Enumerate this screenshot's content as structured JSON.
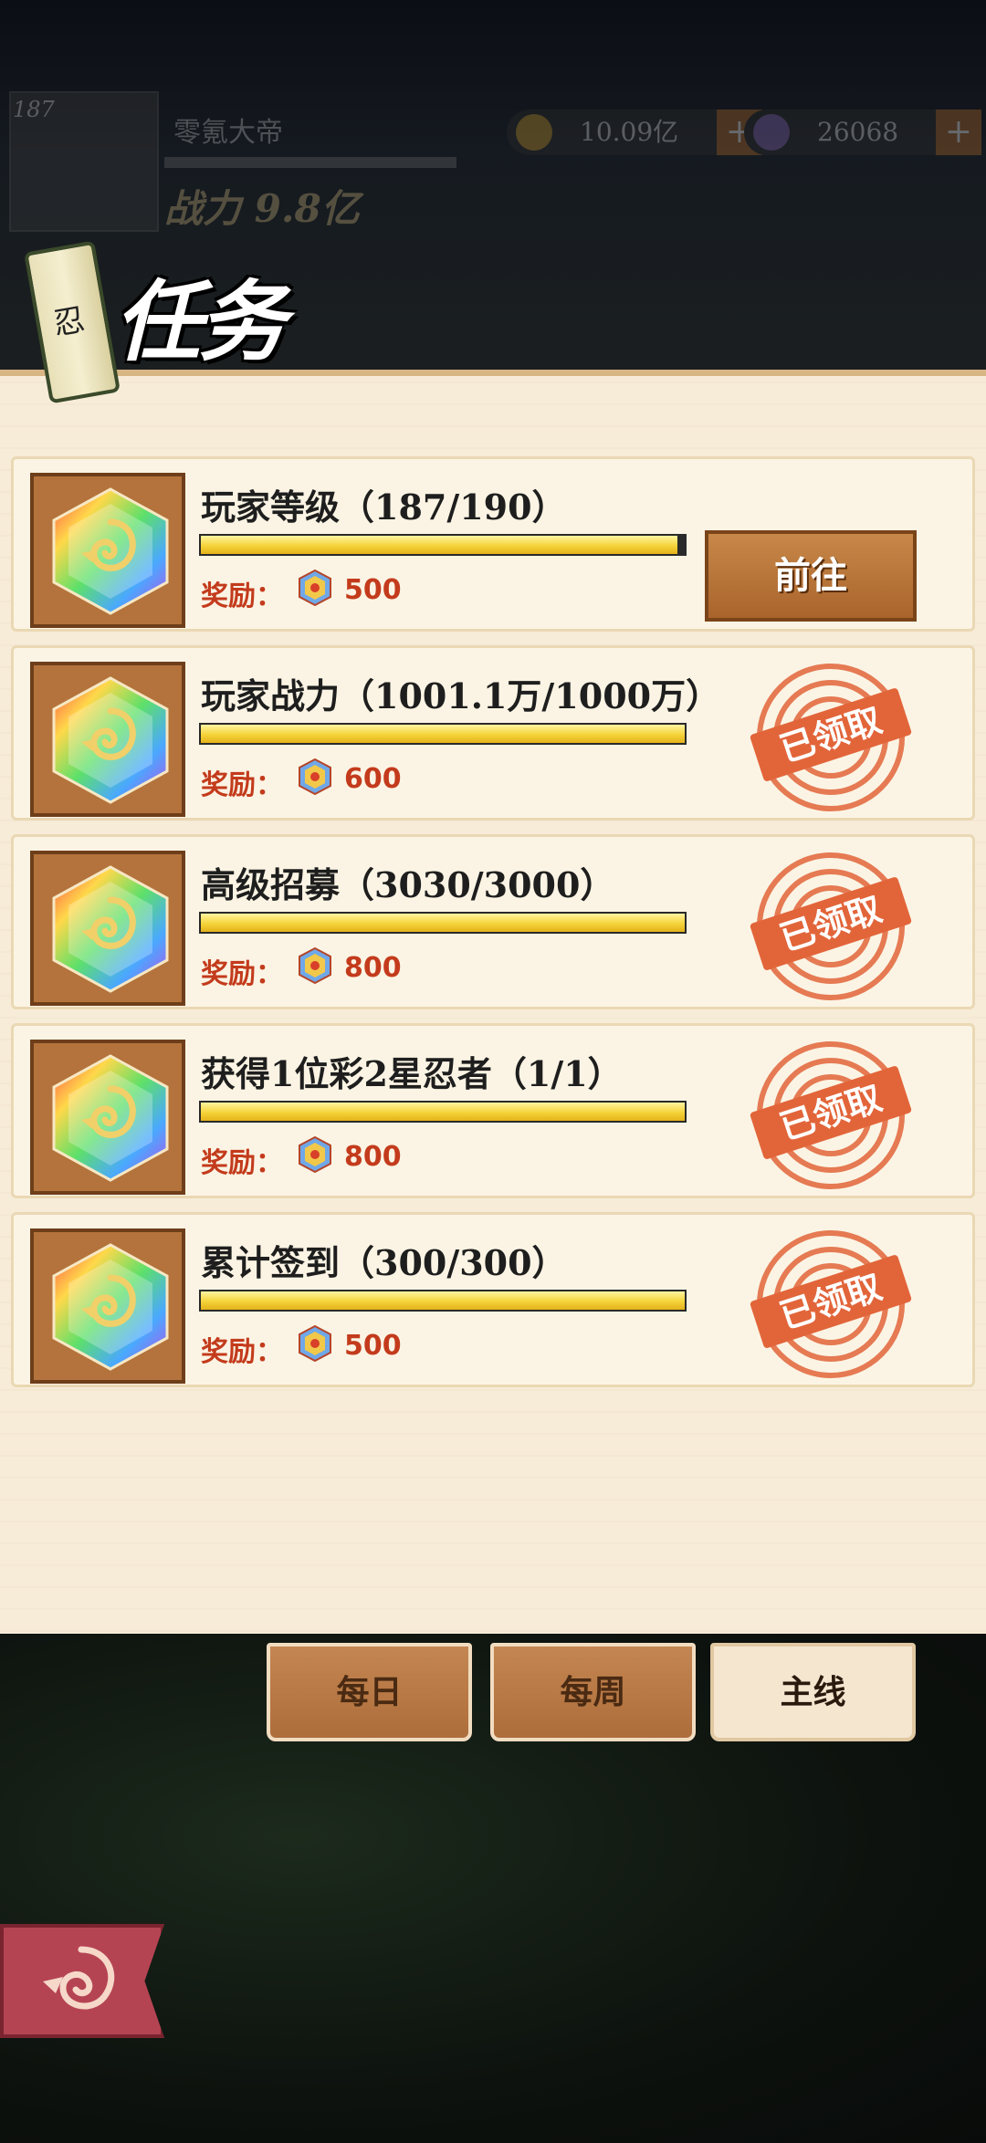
{
  "hud": {
    "level": "187",
    "player_name": "零氪大帝",
    "power": "战力 9.8亿",
    "coins": "10.09亿",
    "gems": "26068",
    "plus": "+"
  },
  "title": {
    "scroll_char": "忍",
    "text": "任务"
  },
  "tasks": [
    {
      "name": "玩家等级（187/190）",
      "reward_label": "奖励：",
      "reward": "500",
      "progress": 0.985,
      "status": "前往"
    },
    {
      "name": "玩家战力（1001.1万/1000万）",
      "reward_label": "奖励：",
      "reward": "600",
      "progress": 1.0,
      "status": "已领取"
    },
    {
      "name": "高级招募（3030/3000）",
      "reward_label": "奖励：",
      "reward": "800",
      "progress": 1.0,
      "status": "已领取"
    },
    {
      "name": "获得1位彩2星忍者（1/1）",
      "reward_label": "奖励：",
      "reward": "800",
      "progress": 1.0,
      "status": "已领取"
    },
    {
      "name": "累计签到（300/300）",
      "reward_label": "奖励：",
      "reward": "500",
      "progress": 1.0,
      "status": "已领取"
    }
  ],
  "tabs": [
    {
      "label": "每日",
      "active": false
    },
    {
      "label": "每周",
      "active": false
    },
    {
      "label": "主线",
      "active": true
    }
  ],
  "colors": {
    "reward_red": "#c33b1c",
    "bar_yellow": "#f5d33a",
    "stamp_orange": "#e2653a",
    "go_button": "#b8743a"
  },
  "icons": [
    "rainbow-leaf-gem-icon",
    "reward-gem-icon",
    "leaf-swirl-back-icon"
  ]
}
